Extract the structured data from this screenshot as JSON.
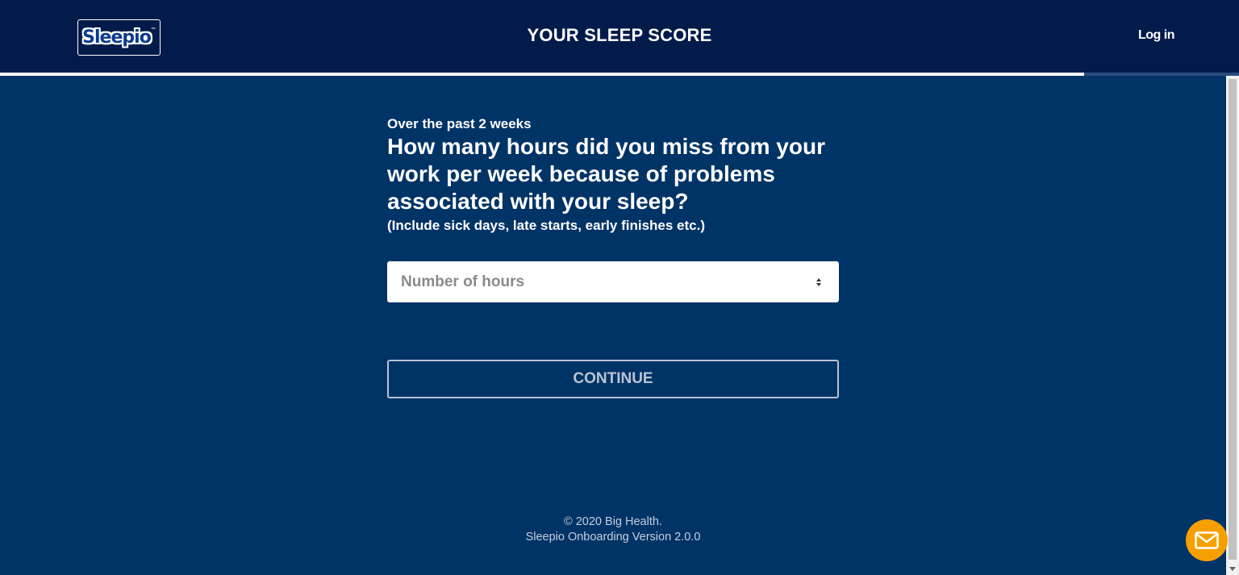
{
  "header": {
    "logo_text": "Sleepio",
    "logo_tm": "™",
    "title": "YOUR SLEEP SCORE",
    "login_label": "Log in"
  },
  "progress": {
    "fraction": 0.875
  },
  "question": {
    "eyebrow": "Over the past 2 weeks",
    "text": "How many hours did you miss from your work per week because of problems associated with your sleep?",
    "hint": "(Include sick days, late starts, early finishes etc.)"
  },
  "form": {
    "hours_placeholder": "Number of hours",
    "hours_value": "",
    "continue_label": "CONTINUE"
  },
  "footer": {
    "copyright": "© 2020 Big Health.",
    "version": "Sleepio Onboarding Version 2.0.0"
  },
  "colors": {
    "page_background": "#003366",
    "header_background": "#021b4a",
    "chat_button": "#f5a000"
  },
  "icons": {
    "chat": "mail-envelope-icon"
  }
}
